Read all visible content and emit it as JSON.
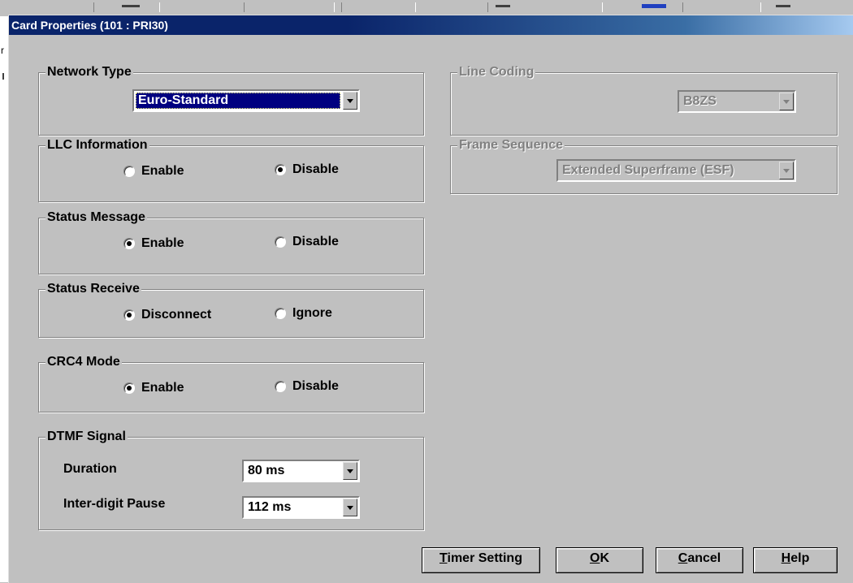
{
  "window": {
    "title": "Card Properties (101 : PRI30)"
  },
  "background": {
    "left_fragment": "r"
  },
  "network_type": {
    "legend": "Network Type",
    "selected": "Euro-Standard"
  },
  "llc_information": {
    "legend": "LLC Information",
    "options": [
      {
        "label": "Enable",
        "checked": false
      },
      {
        "label": "Disable",
        "checked": true
      }
    ]
  },
  "status_message": {
    "legend": "Status Message",
    "options": [
      {
        "label": "Enable",
        "checked": true
      },
      {
        "label": "Disable",
        "checked": false
      }
    ]
  },
  "status_receive": {
    "legend": "Status Receive",
    "options": [
      {
        "label": "Disconnect",
        "checked": true
      },
      {
        "label": "Ignore",
        "checked": false
      }
    ]
  },
  "crc4_mode": {
    "legend": "CRC4 Mode",
    "options": [
      {
        "label": "Enable",
        "checked": true
      },
      {
        "label": "Disable",
        "checked": false
      }
    ]
  },
  "dtmf_signal": {
    "legend": "DTMF Signal",
    "duration_label": "Duration",
    "duration_value": "80 ms",
    "pause_label": "Inter-digit Pause",
    "pause_value": "112 ms"
  },
  "line_coding": {
    "legend": "Line Coding",
    "selected": "B8ZS",
    "enabled": false
  },
  "frame_sequence": {
    "legend": "Frame Sequence",
    "selected": "Extended Superframe (ESF)",
    "enabled": false
  },
  "buttons": {
    "timer_setting": {
      "underline": "T",
      "rest": "imer Setting"
    },
    "ok": {
      "underline": "O",
      "rest": "K"
    },
    "cancel": {
      "underline": "C",
      "rest": "ancel"
    },
    "help": {
      "underline": "H",
      "rest": "elp"
    }
  },
  "colors": {
    "titlebar": "#0a246a",
    "selection": "#000080",
    "face": "#c0c0c0",
    "disabled_text": "#808080"
  }
}
